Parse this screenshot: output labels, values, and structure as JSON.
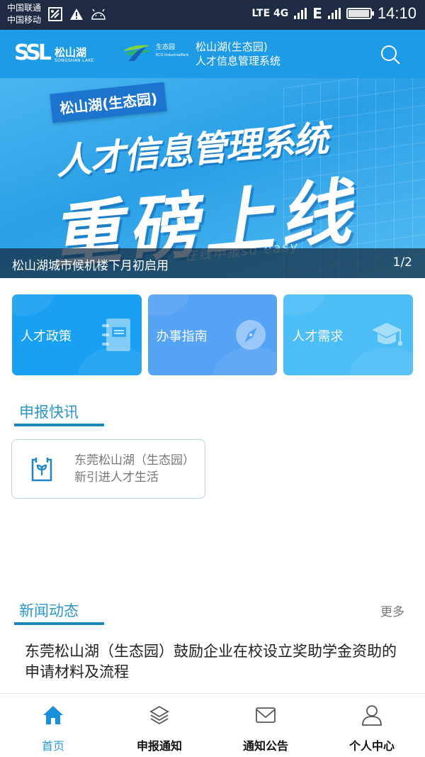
{
  "status_bar": {
    "carrier_1": "中国联通",
    "carrier_2": "中国移动",
    "left_icons": [
      "image-icon",
      "warning-icon",
      "android-icon"
    ],
    "network_1": "LTE 4G",
    "network_2": "E",
    "time": "14:10"
  },
  "header": {
    "logo_mark": "SSL",
    "logo_cn": "松山湖",
    "logo_en": "SONGSHAN LAKE",
    "eco_cn": "生态园",
    "eco_en": "ECO IndustrialPark",
    "title_line1": "松山湖(生态园)",
    "title_line2": "人才信息管理系统",
    "search_icon": "search-icon"
  },
  "banner": {
    "tag": "松山湖(生态园)",
    "headline_1": "人才信息管理系统",
    "headline_2": "重磅上线",
    "subtitle": "在线申报so easy",
    "caption": "松山湖城市候机楼下月初启用",
    "pager": "1/2"
  },
  "quick_cards": [
    {
      "label": "人才政策",
      "icon": "notebook-icon",
      "color": "#1aa0f2"
    },
    {
      "label": "办事指南",
      "icon": "compass-icon",
      "color": "#55a3f5"
    },
    {
      "label": "人才需求",
      "icon": "graduation-cap-icon",
      "color": "#4cbdf5"
    }
  ],
  "flash_section": {
    "title": "申报快讯",
    "items": [
      {
        "text": "东莞松山湖（生态园）新引进人才生活",
        "icon": "sprout-calendar-icon"
      }
    ]
  },
  "news_section": {
    "title": "新闻动态",
    "more": "更多",
    "items": [
      {
        "title": "东莞松山湖（生态园）鼓励企业在校设立奖助学金资助的申请材料及流程"
      }
    ]
  },
  "bottom_nav": [
    {
      "label": "首页",
      "icon": "home-icon",
      "active": true
    },
    {
      "label": "申报通知",
      "icon": "layers-icon",
      "active": false
    },
    {
      "label": "通知公告",
      "icon": "mail-icon",
      "active": false
    },
    {
      "label": "个人中心",
      "icon": "user-icon",
      "active": false
    }
  ],
  "colors": {
    "header_blue": "#1e9be6",
    "accent": "#2a9ad8",
    "section_underline": "#1f86c2",
    "status_bar": "#1f2a44"
  }
}
